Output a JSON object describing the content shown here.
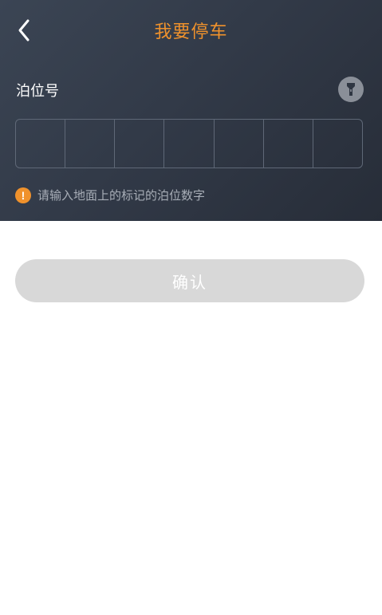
{
  "header": {
    "title": "我要停车",
    "back_icon": "chevron-left-icon"
  },
  "form": {
    "label": "泊位号",
    "flashlight_icon": "flashlight-icon",
    "code_cells": [
      "",
      "",
      "",
      "",
      "",
      "",
      ""
    ],
    "hint_icon": "warning-icon",
    "hint_icon_glyph": "!",
    "hint": "请输入地面上的标记的泊位数字"
  },
  "actions": {
    "confirm_label": "确认"
  },
  "colors": {
    "accent": "#f0922c",
    "header_bg": "#323a48",
    "button_disabled": "#d8d8d8"
  }
}
